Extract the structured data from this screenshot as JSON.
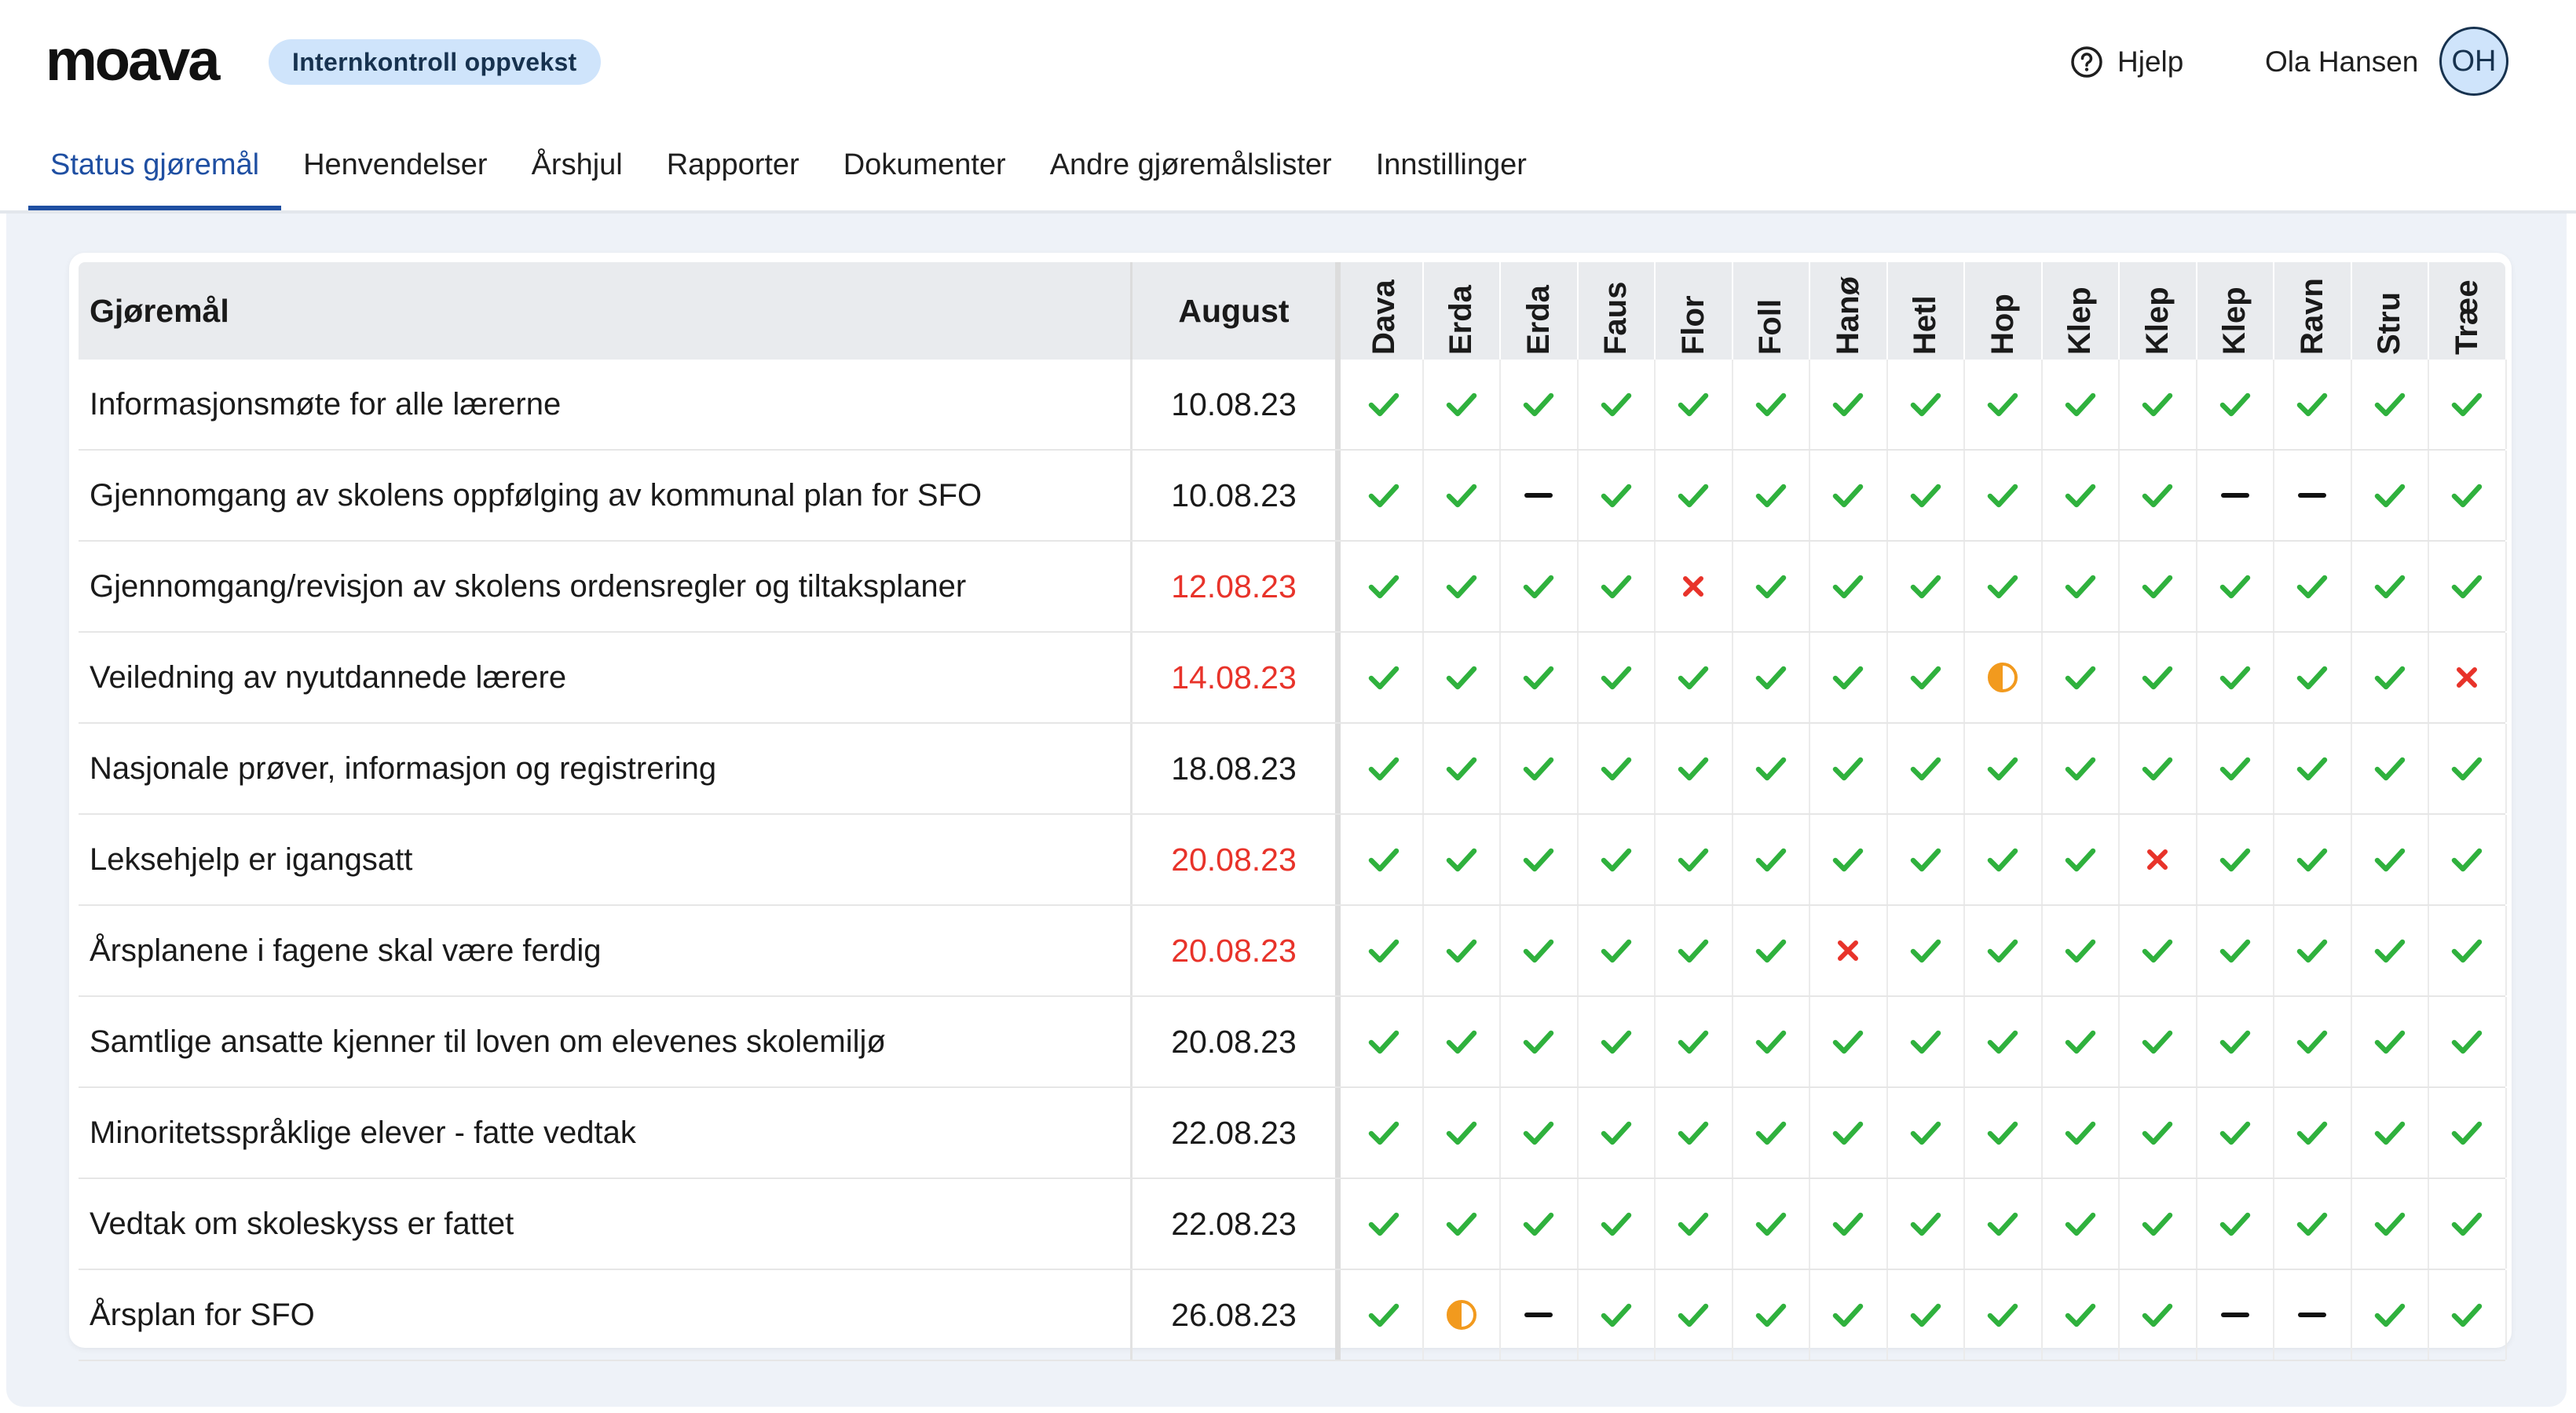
{
  "app": {
    "logo_text": "moava",
    "scope_badge": "Internkontroll oppvekst"
  },
  "topbar": {
    "help_label": "Hjelp",
    "user_name": "Ola Hansen",
    "user_initials": "OH"
  },
  "nav": {
    "tabs": [
      {
        "label": "Status gjøremål",
        "active": true
      },
      {
        "label": "Henvendelser",
        "active": false
      },
      {
        "label": "Årshjul",
        "active": false
      },
      {
        "label": "Rapporter",
        "active": false
      },
      {
        "label": "Dokumenter",
        "active": false
      },
      {
        "label": "Andre gjøremålslister",
        "active": false
      },
      {
        "label": "Innstillinger",
        "active": false
      }
    ]
  },
  "colors": {
    "accent": "#1f4fa2",
    "done": "#2fb13d",
    "missing": "#e8332a",
    "partial": "#f29a1e",
    "not_applicable": "#111111",
    "late_date": "#e8332a"
  },
  "status_legend": {
    "check": "check-icon",
    "cross": "cross-icon",
    "half": "half-circle-icon",
    "dash": "dash-icon"
  },
  "table": {
    "task_header": "Gjøremål",
    "date_header": "August",
    "units": [
      "Dava",
      "Erda",
      "Erda",
      "Faus",
      "Flor",
      "Foll",
      "Hanø",
      "Hetl",
      "Hop",
      "Klep",
      "Klep",
      "Klep",
      "Ravn",
      "Stru",
      "Træe"
    ],
    "rows": [
      {
        "task": "Informasjonsmøte for alle lærerne",
        "date": "10.08.23",
        "late": false,
        "status": [
          "check",
          "check",
          "check",
          "check",
          "check",
          "check",
          "check",
          "check",
          "check",
          "check",
          "check",
          "check",
          "check",
          "check",
          "check"
        ]
      },
      {
        "task": "Gjennomgang av skolens oppfølging av kommunal plan for SFO",
        "date": "10.08.23",
        "late": false,
        "status": [
          "check",
          "check",
          "dash",
          "check",
          "check",
          "check",
          "check",
          "check",
          "check",
          "check",
          "check",
          "dash",
          "dash",
          "check",
          "check"
        ]
      },
      {
        "task": "Gjennomgang/revisjon av skolens ordensregler og tiltaksplaner",
        "date": "12.08.23",
        "late": true,
        "status": [
          "check",
          "check",
          "check",
          "check",
          "cross",
          "check",
          "check",
          "check",
          "check",
          "check",
          "check",
          "check",
          "check",
          "check",
          "check"
        ]
      },
      {
        "task": "Veiledning av nyutdannede lærere",
        "date": "14.08.23",
        "late": true,
        "status": [
          "check",
          "check",
          "check",
          "check",
          "check",
          "check",
          "check",
          "check",
          "half",
          "check",
          "check",
          "check",
          "check",
          "check",
          "cross"
        ]
      },
      {
        "task": "Nasjonale prøver, informasjon og registrering",
        "date": "18.08.23",
        "late": false,
        "status": [
          "check",
          "check",
          "check",
          "check",
          "check",
          "check",
          "check",
          "check",
          "check",
          "check",
          "check",
          "check",
          "check",
          "check",
          "check"
        ]
      },
      {
        "task": "Leksehjelp er igangsatt",
        "date": "20.08.23",
        "late": true,
        "status": [
          "check",
          "check",
          "check",
          "check",
          "check",
          "check",
          "check",
          "check",
          "check",
          "check",
          "cross",
          "check",
          "check",
          "check",
          "check"
        ]
      },
      {
        "task": "Årsplanene i fagene skal være ferdig",
        "date": "20.08.23",
        "late": true,
        "status": [
          "check",
          "check",
          "check",
          "check",
          "check",
          "check",
          "cross",
          "check",
          "check",
          "check",
          "check",
          "check",
          "check",
          "check",
          "check"
        ]
      },
      {
        "task": "Samtlige ansatte kjenner til loven om elevenes skolemiljø",
        "date": "20.08.23",
        "late": false,
        "status": [
          "check",
          "check",
          "check",
          "check",
          "check",
          "check",
          "check",
          "check",
          "check",
          "check",
          "check",
          "check",
          "check",
          "check",
          "check"
        ]
      },
      {
        "task": "Minoritetsspråklige elever - fatte vedtak",
        "date": "22.08.23",
        "late": false,
        "status": [
          "check",
          "check",
          "check",
          "check",
          "check",
          "check",
          "check",
          "check",
          "check",
          "check",
          "check",
          "check",
          "check",
          "check",
          "check"
        ]
      },
      {
        "task": "Vedtak om skoleskyss er fattet",
        "date": "22.08.23",
        "late": false,
        "status": [
          "check",
          "check",
          "check",
          "check",
          "check",
          "check",
          "check",
          "check",
          "check",
          "check",
          "check",
          "check",
          "check",
          "check",
          "check"
        ]
      },
      {
        "task": "Årsplan for SFO",
        "date": "26.08.23",
        "late": false,
        "status": [
          "check",
          "half",
          "dash",
          "check",
          "check",
          "check",
          "check",
          "check",
          "check",
          "check",
          "check",
          "dash",
          "dash",
          "check",
          "check"
        ]
      }
    ]
  }
}
